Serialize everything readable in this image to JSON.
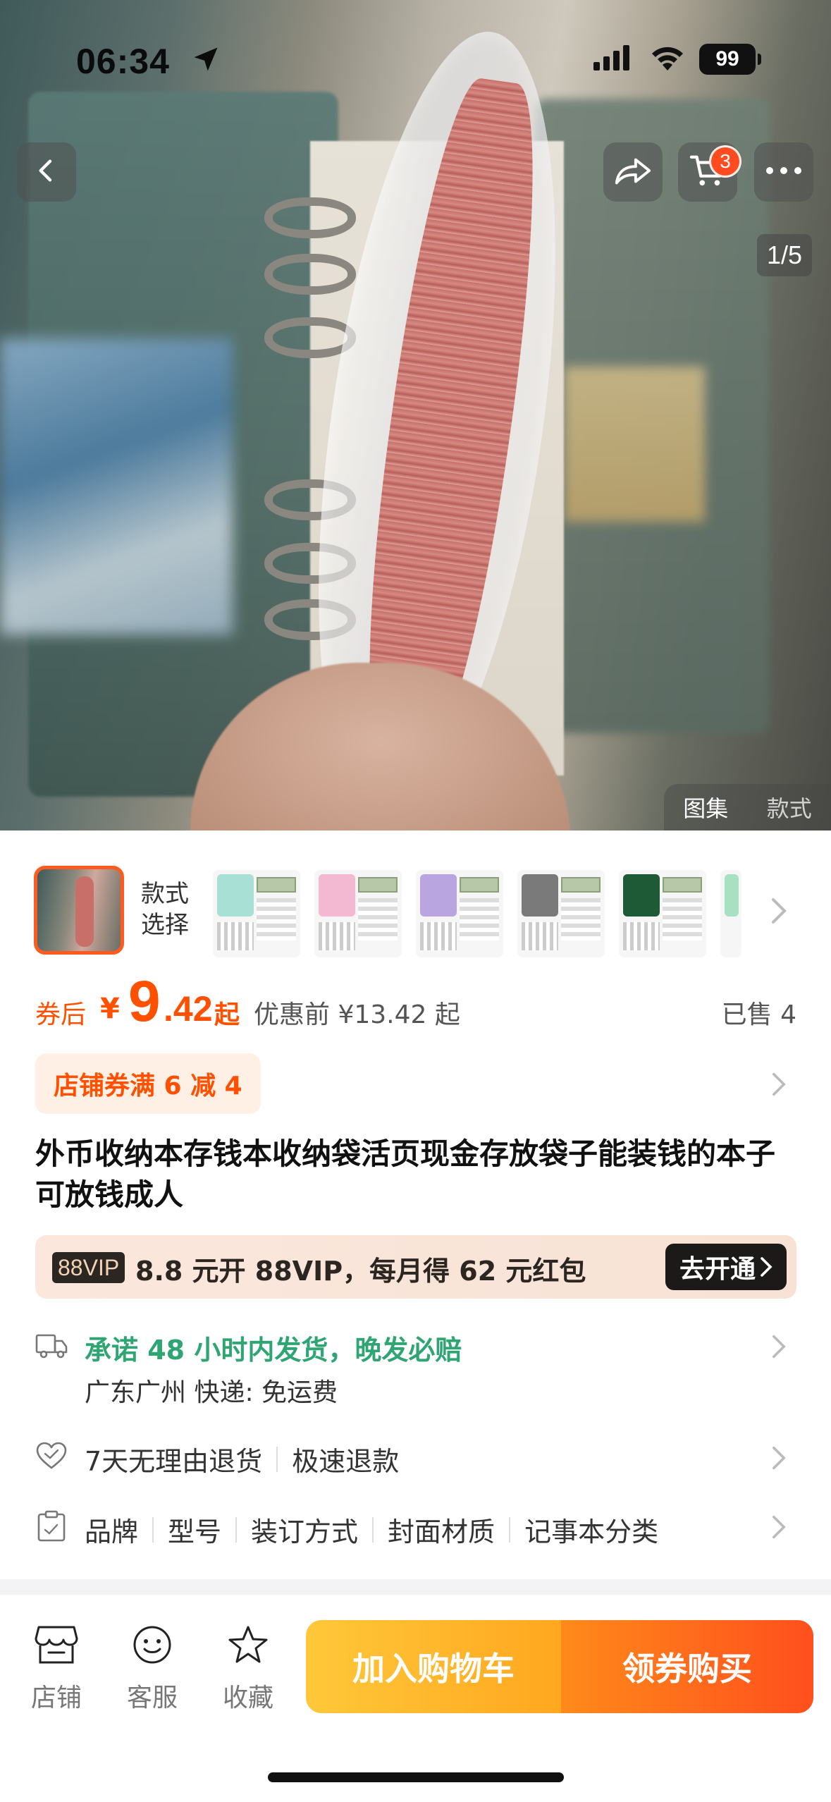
{
  "status_bar": {
    "time": "06:34",
    "battery": "99"
  },
  "header": {
    "cart_count": "3",
    "image_index": "1/5"
  },
  "gallery_tabs": {
    "album": "图集",
    "style": "款式"
  },
  "variants": {
    "label_line1": "款式",
    "label_line2": "选择",
    "cover_colors": [
      "#a8e0d6",
      "#f3b9d2",
      "#b9a6e0",
      "#7a7a7a",
      "#1f5a36"
    ]
  },
  "price": {
    "after_label": "券后",
    "currency": "¥",
    "integer": "9",
    "decimal": ".42",
    "suffix": "起",
    "before": "优惠前 ¥13.42 起",
    "sold": "已售 4"
  },
  "coupon": {
    "text": "店铺券满 6 减 4"
  },
  "product": {
    "title": "外币收纳本存钱本收纳袋活页现金存放袋子能装钱的本子可放钱成人"
  },
  "vip": {
    "badge": "88VIP",
    "text": "8.8 元开 88VIP，每月得 62 元红包",
    "button": "去开通"
  },
  "shipping": {
    "promise": "承诺 48 小时内发货，晚发必赔",
    "origin": "广东广州  快递: 免运费"
  },
  "returns": {
    "policy": "7天无理由退货",
    "refund": "极速退款"
  },
  "attributes": [
    "品牌",
    "型号",
    "装订方式",
    "封面材质",
    "记事本分类"
  ],
  "bottom_bar": {
    "shop": "店铺",
    "service": "客服",
    "favorite": "收藏",
    "add_to_cart": "加入购物车",
    "buy": "领券购买"
  },
  "colors": {
    "accent": "#ff5000",
    "green": "#2fa574"
  }
}
